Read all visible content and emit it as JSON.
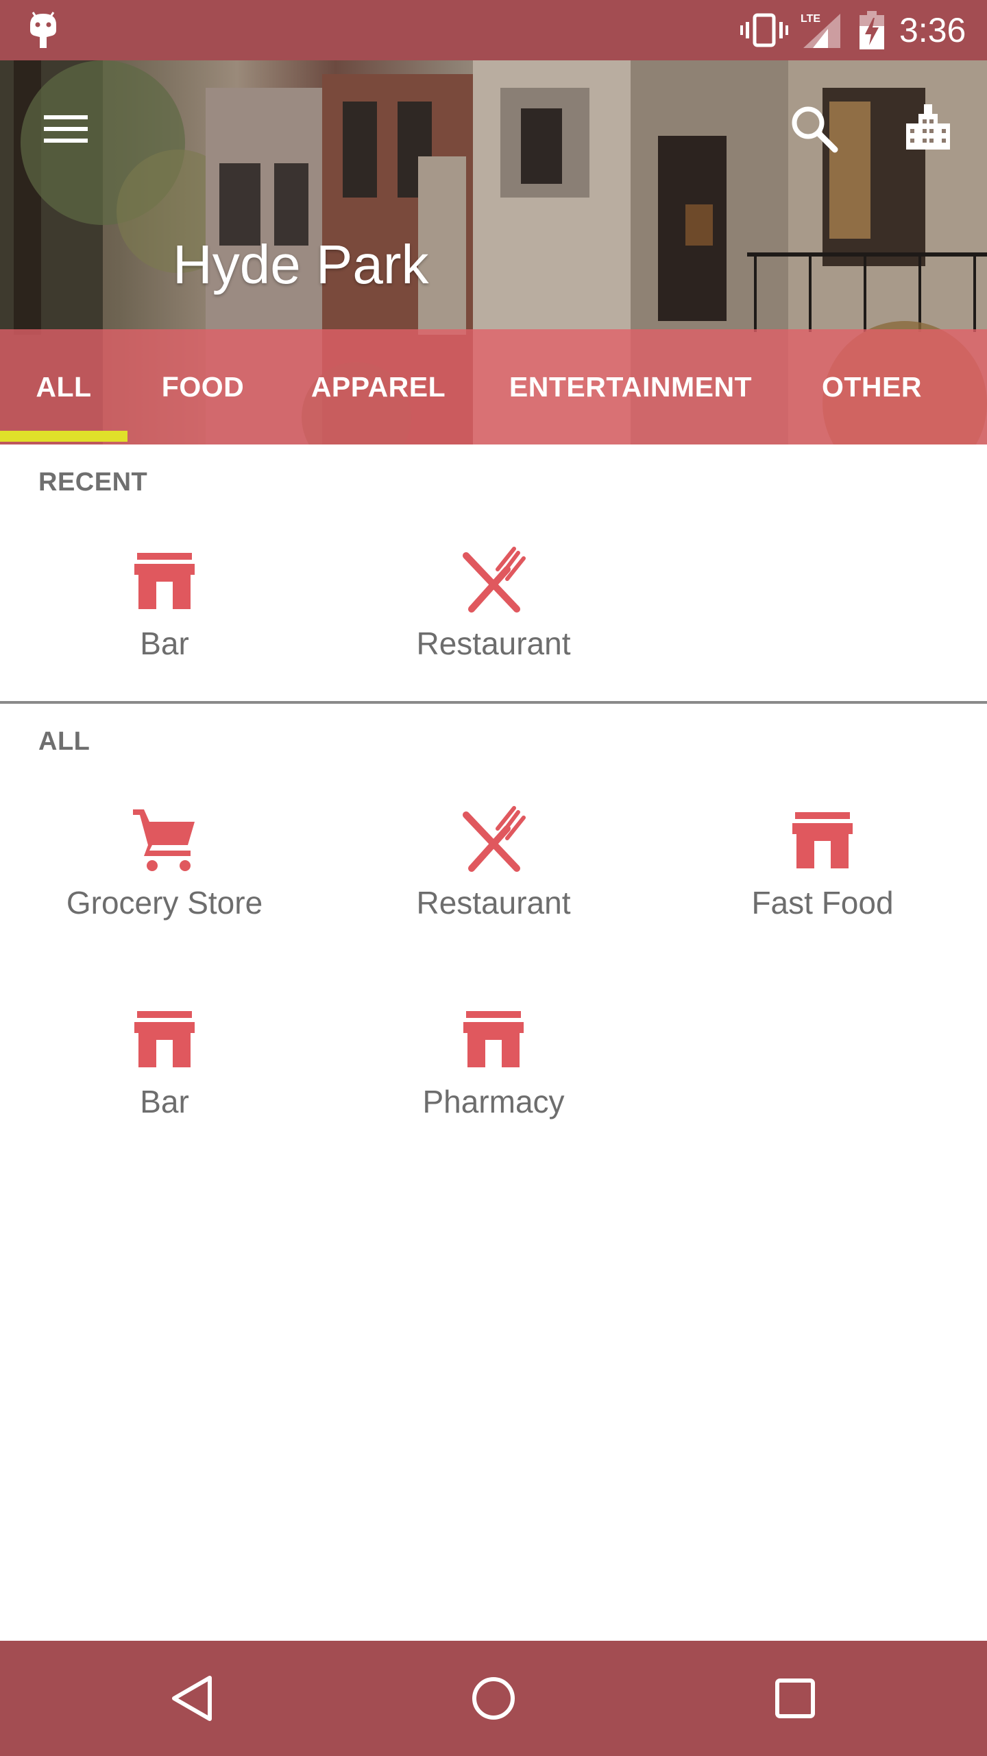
{
  "status_bar": {
    "time": "3:36",
    "icons": [
      "android-icon",
      "vibrate-icon",
      "lte-signal-icon",
      "battery-charging-icon"
    ]
  },
  "header": {
    "title": "Hyde Park",
    "icons": [
      "menu-icon",
      "search-icon",
      "city-icon"
    ]
  },
  "tabs": [
    {
      "label": "ALL",
      "selected": true
    },
    {
      "label": "FOOD",
      "selected": false
    },
    {
      "label": "APPAREL",
      "selected": false
    },
    {
      "label": "ENTERTAINMENT",
      "selected": false
    },
    {
      "label": "OTHER",
      "selected": false
    }
  ],
  "recent": {
    "heading": "RECENT",
    "items": [
      {
        "label": "Bar",
        "icon": "store-icon"
      },
      {
        "label": "Restaurant",
        "icon": "utensils-icon"
      }
    ]
  },
  "all": {
    "heading": "ALL",
    "items": [
      {
        "label": "Grocery Store",
        "icon": "cart-icon"
      },
      {
        "label": "Restaurant",
        "icon": "utensils-icon"
      },
      {
        "label": "Fast Food",
        "icon": "store-icon"
      },
      {
        "label": "Bar",
        "icon": "store-icon"
      },
      {
        "label": "Pharmacy",
        "icon": "store-icon"
      }
    ]
  },
  "nav_bar": {
    "icons": [
      "back-icon",
      "home-icon",
      "recents-icon"
    ]
  },
  "colors": {
    "bars": "#a34d52",
    "tab_overlay": "#e26068",
    "accent_icon": "#e0585e",
    "indicator": "#e0e02a"
  }
}
